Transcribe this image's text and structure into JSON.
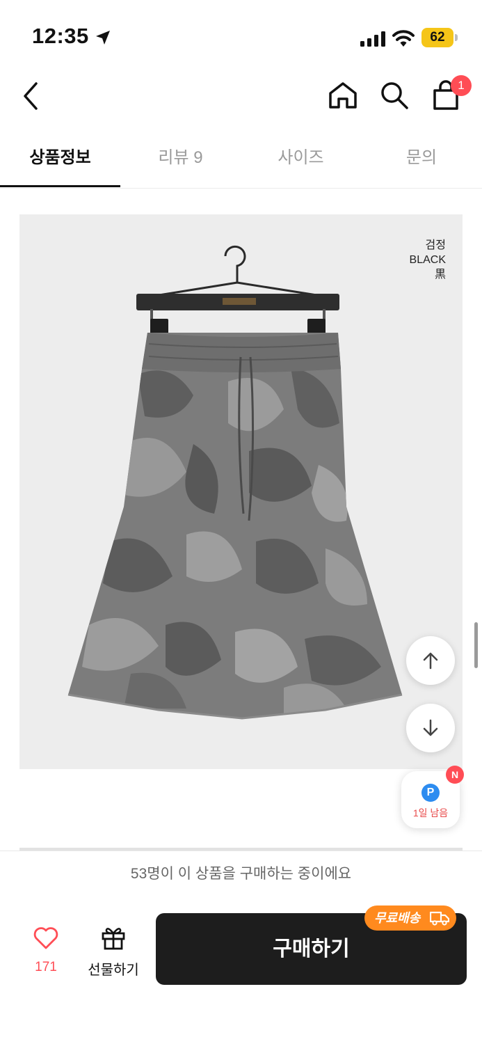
{
  "status_bar": {
    "time": "12:35",
    "battery": "62"
  },
  "nav": {
    "cart_count": "1"
  },
  "tabs": [
    {
      "label": "상품정보",
      "active": true
    },
    {
      "label": "리뷰 9",
      "active": false
    },
    {
      "label": "사이즈",
      "active": false
    },
    {
      "label": "문의",
      "active": false
    }
  ],
  "product_image": {
    "color_label": [
      "검정",
      "BLACK",
      "黒"
    ]
  },
  "point_widget": {
    "label": "1일 남음",
    "icon_letter": "P",
    "badge": "N"
  },
  "viewer_banner": "53명이 이 상품을 구매하는 중이에요",
  "bottom_bar": {
    "like_count": "171",
    "gift_label": "선물하기",
    "buy_label": "구매하기",
    "free_shipping": "무료배송"
  },
  "colors": {
    "accent": "#ff4d55",
    "buy_button": "#1d1d1d",
    "free_shipping": "#ff8a1e",
    "battery": "#f5c518",
    "point_blue": "#2d8cf0"
  },
  "icons": [
    "location-arrow-icon",
    "signal-icon",
    "wifi-icon",
    "back-icon",
    "home-icon",
    "search-icon",
    "cart-icon",
    "arrow-up-icon",
    "arrow-down-icon",
    "heart-icon",
    "gift-icon",
    "truck-icon"
  ]
}
